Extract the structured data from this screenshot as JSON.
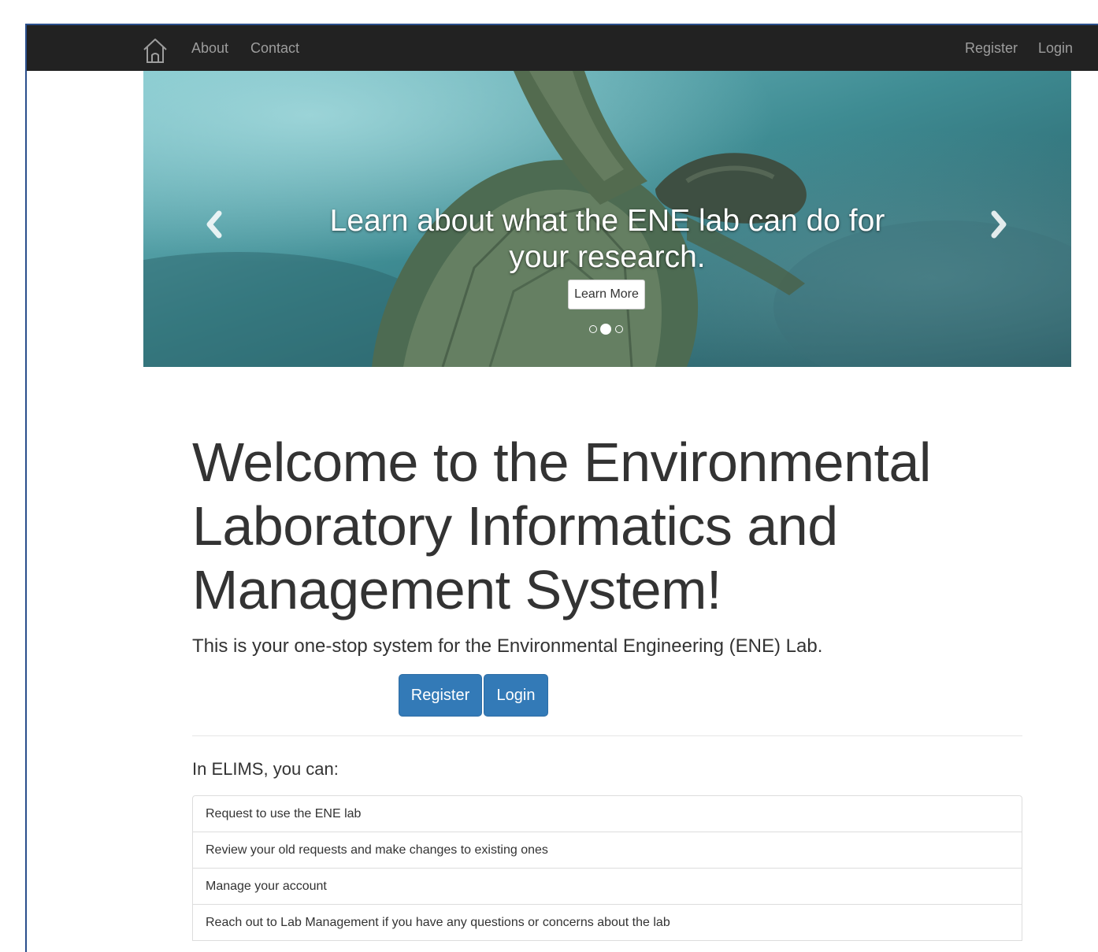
{
  "navbar": {
    "home_icon": "home-icon",
    "about": "About",
    "contact": "Contact",
    "register": "Register",
    "login": "Login",
    "background_color": "#222222",
    "link_color": "#9d9d9d"
  },
  "carousel": {
    "caption": "Learn about what the ENE lab can do for your research.",
    "button_label": "Learn More",
    "slide_count": 3,
    "active_slide": 2,
    "prev_icon": "chevron-left-icon",
    "next_icon": "chevron-right-icon"
  },
  "jumbotron": {
    "title": "Welcome to the Environmental Laboratory Informatics and Management System!",
    "lead": "This is your one-stop system for the Environmental Engineering (ENE) Lab.",
    "register_label": "Register",
    "login_label": "Login",
    "button_color": "#337ab7"
  },
  "features": {
    "heading": "In ELIMS, you can:",
    "items": [
      "Request to use the ENE lab",
      "Review your old requests and make changes to existing ones",
      "Manage your account",
      "Reach out to Lab Management if you have any questions or concerns about the lab"
    ]
  }
}
